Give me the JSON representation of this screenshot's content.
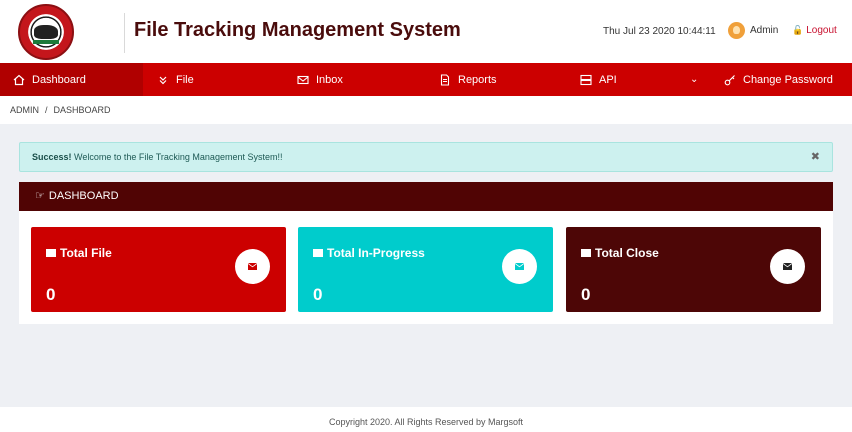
{
  "header": {
    "title": "File Tracking Management System",
    "datetime": "Thu Jul 23 2020 10:44:11",
    "user": "Admin",
    "logout": "Logout"
  },
  "nav": {
    "items": [
      {
        "label": "Dashboard",
        "icon": "home-icon"
      },
      {
        "label": "File",
        "icon": "chevrons-down-icon"
      },
      {
        "label": "Inbox",
        "icon": "mail-icon"
      },
      {
        "label": "Reports",
        "icon": "report-icon"
      },
      {
        "label": "API",
        "icon": "server-icon"
      },
      {
        "label": "Change Password",
        "icon": "key-icon"
      }
    ]
  },
  "breadcrumb": [
    "ADMIN",
    "DASHBOARD"
  ],
  "alert": {
    "strong": "Success!",
    "message": "Welcome to the File Tracking Management System!!"
  },
  "panel": {
    "title": "DASHBOARD"
  },
  "cards": [
    {
      "title": "Total File",
      "value": "0",
      "color": "#cc0000",
      "icon_color": "#cc0000"
    },
    {
      "title": "Total In-Progress",
      "value": "0",
      "color": "#00cccc",
      "icon_color": "#00cccc"
    },
    {
      "title": "Total Close",
      "value": "0",
      "color": "#4d0606",
      "icon_color": "#222222"
    }
  ],
  "footer": "Copyright 2020. All Rights Reserved by Margsoft"
}
